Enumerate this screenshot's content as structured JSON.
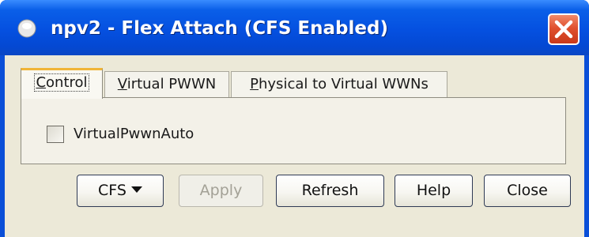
{
  "window": {
    "title": "npv2 - Flex Attach (CFS Enabled)"
  },
  "tabs": [
    {
      "label": "Control",
      "selected": true
    },
    {
      "label": "Virtual PWWN",
      "selected": false
    },
    {
      "label": "Physical to Virtual WWNs",
      "selected": false
    }
  ],
  "control": {
    "checkbox_label": "VirtualPwwnAuto",
    "checked": false
  },
  "buttons": {
    "cfs": "CFS",
    "apply": "Apply",
    "refresh": "Refresh",
    "help": "Help",
    "close": "Close"
  },
  "icons": {
    "app": "circle-app-icon",
    "close": "close-x-icon",
    "cfs_menu": "chevron-down-icon"
  },
  "colors": {
    "titlebar": "#0550e0",
    "close_button": "#e0512f",
    "dialog_background": "#ece9d8",
    "active_tab_accent": "#f0b437"
  }
}
